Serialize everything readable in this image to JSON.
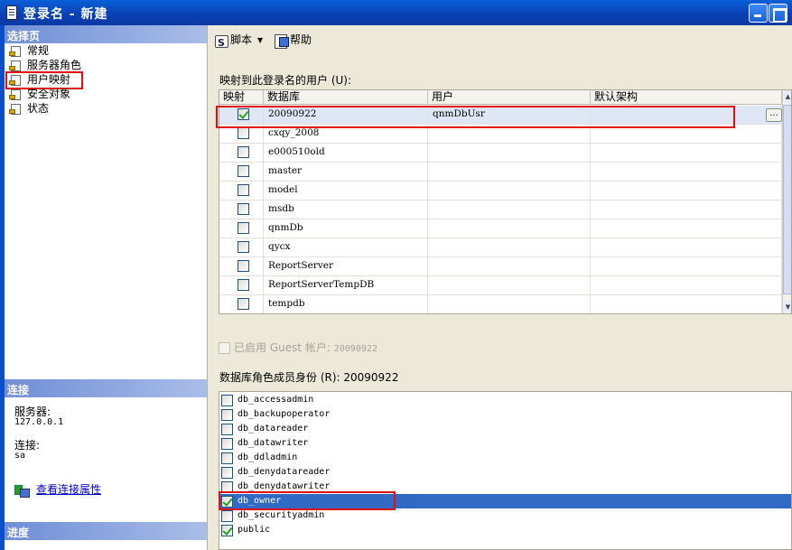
{
  "window": {
    "title": "登录名 - 新建"
  },
  "left": {
    "select_page_header": "选择页",
    "pages": [
      {
        "label": "常规",
        "selected": false
      },
      {
        "label": "服务器角色",
        "selected": false
      },
      {
        "label": "用户映射",
        "selected": true
      },
      {
        "label": "安全对象",
        "selected": false
      },
      {
        "label": "状态",
        "selected": false
      }
    ],
    "connection_header": "连接",
    "server_label": "服务器:",
    "server_value": "127.0.0.1",
    "connection_label": "连接:",
    "connection_value": "sa",
    "view_props_link": "查看连接属性",
    "progress_header": "进度"
  },
  "toolbar": {
    "script_label": "脚本",
    "help_label": "帮助"
  },
  "mapping": {
    "label": "映射到此登录名的用户 (U):",
    "columns": [
      "映射",
      "数据库",
      "用户",
      "默认架构"
    ],
    "rows": [
      {
        "mapped": true,
        "database": "20090922",
        "user": "qnmDbUsr",
        "schema": "",
        "selected": true
      },
      {
        "mapped": false,
        "database": "cxqy_2008",
        "user": "",
        "schema": ""
      },
      {
        "mapped": false,
        "database": "e000510old",
        "user": "",
        "schema": ""
      },
      {
        "mapped": false,
        "database": "master",
        "user": "",
        "schema": ""
      },
      {
        "mapped": false,
        "database": "model",
        "user": "",
        "schema": ""
      },
      {
        "mapped": false,
        "database": "msdb",
        "user": "",
        "schema": ""
      },
      {
        "mapped": false,
        "database": "qnmDb",
        "user": "",
        "schema": ""
      },
      {
        "mapped": false,
        "database": "qycx",
        "user": "",
        "schema": ""
      },
      {
        "mapped": false,
        "database": "ReportServer",
        "user": "",
        "schema": ""
      },
      {
        "mapped": false,
        "database": "ReportServerTempDB",
        "user": "",
        "schema": ""
      },
      {
        "mapped": false,
        "database": "tempdb",
        "user": "",
        "schema": ""
      }
    ],
    "ellipsis": "..."
  },
  "guest": {
    "label": "已启用 Guest 帐户:",
    "db": "20090922",
    "enabled": false
  },
  "roles": {
    "label": "数据库角色成员身份 (R): 20090922",
    "items": [
      {
        "name": "db_accessadmin",
        "checked": false
      },
      {
        "name": "db_backupoperator",
        "checked": false
      },
      {
        "name": "db_datareader",
        "checked": false
      },
      {
        "name": "db_datawriter",
        "checked": false
      },
      {
        "name": "db_ddladmin",
        "checked": false
      },
      {
        "name": "db_denydatareader",
        "checked": false
      },
      {
        "name": "db_denydatawriter",
        "checked": false
      },
      {
        "name": "db_owner",
        "checked": true,
        "selected": true
      },
      {
        "name": "db_securityadmin",
        "checked": false
      },
      {
        "name": "public",
        "checked": true
      }
    ]
  }
}
